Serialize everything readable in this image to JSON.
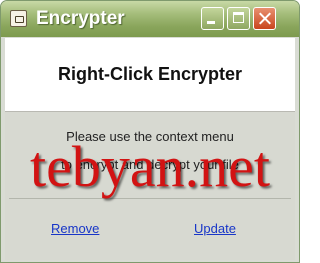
{
  "window": {
    "title": "Encrypter",
    "app_icon": "safe-icon",
    "controls": [
      "minimize",
      "maximize",
      "close"
    ]
  },
  "header": {
    "title": "Right-Click Encrypter"
  },
  "content": {
    "message_line1": "Please use the context menu",
    "message_line2": "to encrypt and decrypt your file"
  },
  "links": {
    "remove": "Remove",
    "update": "Update"
  },
  "watermark": "tebyan.net",
  "colors": {
    "titlebar": "#8aa65c",
    "close_button": "#c9451d",
    "link": "#1836c8",
    "watermark": "#d21313"
  }
}
